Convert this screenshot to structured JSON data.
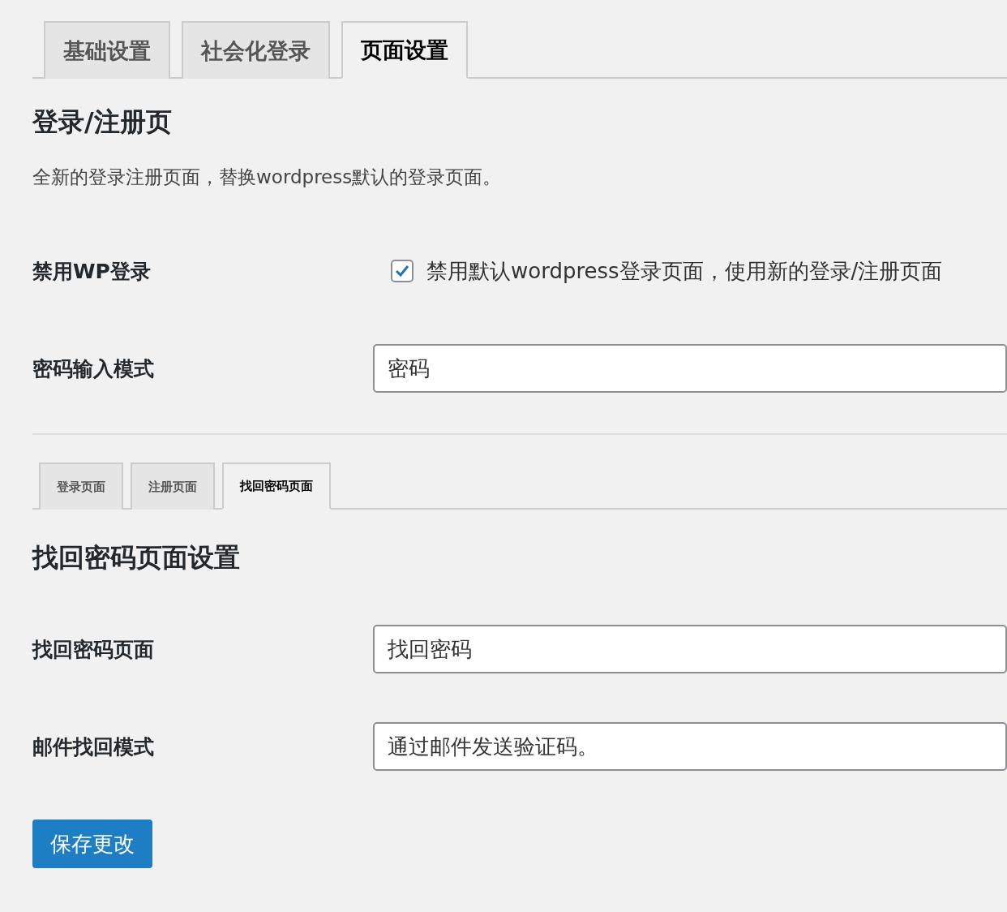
{
  "tabs": [
    {
      "label": "基础设置",
      "selected": false
    },
    {
      "label": "社会化登录",
      "selected": false
    },
    {
      "label": "页面设置",
      "selected": true
    }
  ],
  "section": {
    "title": "登录/注册页",
    "description": "全新的登录注册页面，替换wordpress默认的登录页面。",
    "fields": [
      {
        "kind": "checkbox",
        "label": "禁用WP登录",
        "text": "禁用默认wordpress登录页面，使用新的登录/注册页面",
        "checked": true
      },
      {
        "kind": "input",
        "label": "密码输入模式",
        "value": "密码"
      }
    ]
  },
  "subtabs": [
    {
      "label": "登录页面",
      "selected": false
    },
    {
      "label": "注册页面",
      "selected": false
    },
    {
      "label": "找回密码页面",
      "selected": true
    }
  ],
  "subsection": {
    "title": "找回密码页面设置",
    "fields": [
      {
        "kind": "input",
        "label": "找回密码页面",
        "value": "找回密码"
      },
      {
        "kind": "input",
        "label": "邮件找回模式",
        "value": "通过邮件发送验证码。"
      }
    ]
  },
  "save_button": "保存更改"
}
